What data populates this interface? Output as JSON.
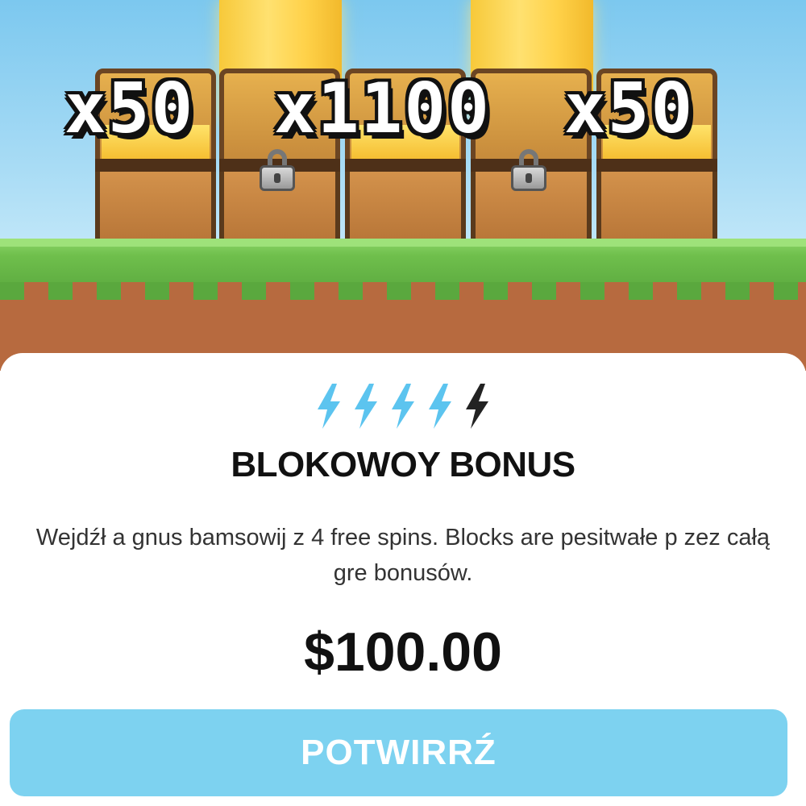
{
  "multipliers": [
    "x50",
    "x1100",
    "x50"
  ],
  "energy": {
    "filled": 4,
    "total": 5,
    "filled_color": "#5cc4ef",
    "empty_color": "#222222"
  },
  "bonus": {
    "title": "BLOKOWOY BONUS",
    "description": "Wejdźł a gnus bamsowij z 4 free spins. Blocks are pesitwałe p zez całą gre bonusów.",
    "price": "$100.00"
  },
  "confirm_label": "POTWIRRŹ",
  "colors": {
    "button": "#7dd2f0",
    "sky": "#7cc8ef",
    "grass": "#6fbf4c",
    "dirt": "#b76a3f"
  }
}
